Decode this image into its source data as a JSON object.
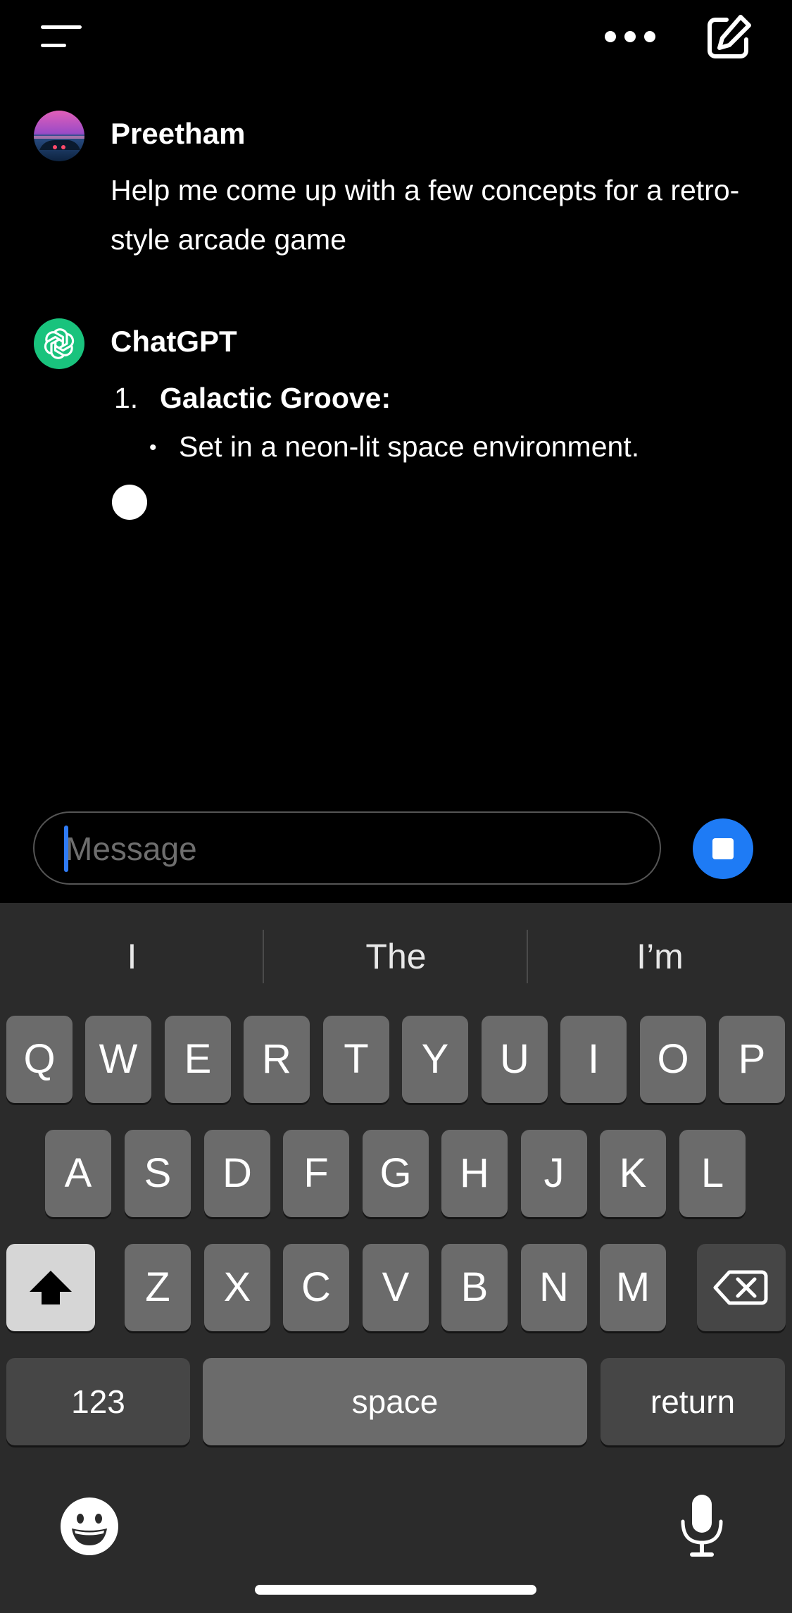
{
  "header": {
    "menu_icon": "menu-icon",
    "more_icon": "more-options-icon",
    "compose_icon": "new-chat-icon"
  },
  "conversation": {
    "user_message": {
      "sender": "Preetham",
      "text": "Help me come up with a few concepts for a retro-style arcade game",
      "avatar_icon": "retro-car-avatar"
    },
    "assistant_message": {
      "sender": "ChatGPT",
      "avatar_icon": "openai-logo-icon",
      "items": [
        {
          "number": "1.",
          "title": "Galactic Groove:",
          "bullets": [
            "Set in a neon-lit space environment."
          ]
        }
      ]
    }
  },
  "composer": {
    "placeholder": "Message",
    "value": "",
    "stop_icon": "stop-generating-icon"
  },
  "keyboard": {
    "suggestions": [
      "I",
      "The",
      "I’m"
    ],
    "row1": [
      "Q",
      "W",
      "E",
      "R",
      "T",
      "Y",
      "U",
      "I",
      "O",
      "P"
    ],
    "row2": [
      "A",
      "S",
      "D",
      "F",
      "G",
      "H",
      "J",
      "K",
      "L"
    ],
    "row3": [
      "Z",
      "X",
      "C",
      "V",
      "B",
      "N",
      "M"
    ],
    "numbers_label": "123",
    "space_label": "space",
    "return_label": "return",
    "shift_icon": "shift-icon",
    "delete_icon": "delete-icon",
    "emoji_icon": "emoji-icon",
    "mic_icon": "microphone-icon"
  },
  "colors": {
    "background": "#000000",
    "keyboard_bg": "#2b2b2b",
    "key": "#6b6b6b",
    "accent": "#1e7bf5",
    "chatgpt_green": "#19c37d"
  }
}
